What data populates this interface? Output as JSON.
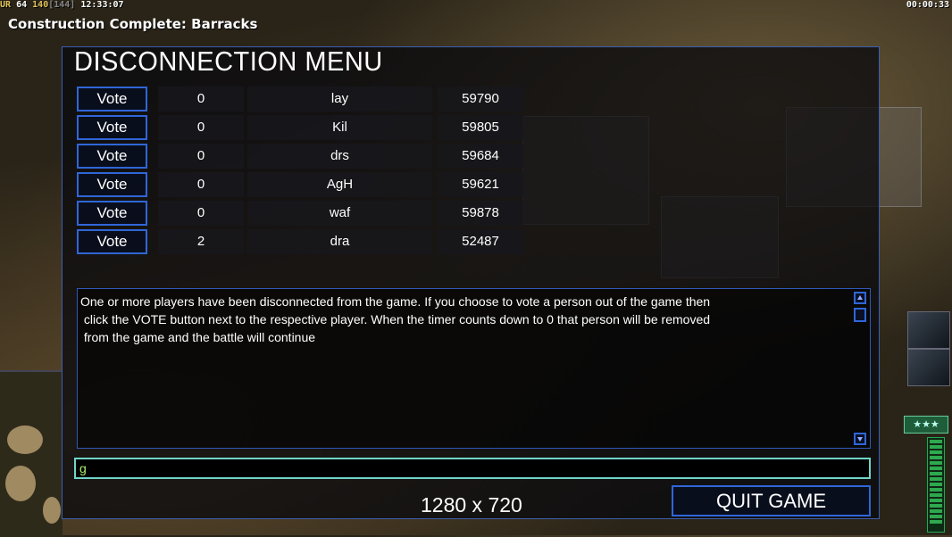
{
  "hud": {
    "ur_label": "UR",
    "stat_a": "64",
    "stat_b": "140",
    "stat_c": "[144]",
    "clock": "12:33:07",
    "game_timer": "00:00:33"
  },
  "notification": "Construction Complete: Barracks",
  "dialog": {
    "title": "DISCONNECTION MENU",
    "vote_label": "Vote",
    "players": [
      {
        "votes": "0",
        "name": "lay",
        "ping": "59790"
      },
      {
        "votes": "0",
        "name": "Kil",
        "ping": "59805"
      },
      {
        "votes": "0",
        "name": "drs",
        "ping": "59684"
      },
      {
        "votes": "0",
        "name": "AgH",
        "ping": "59621"
      },
      {
        "votes": "0",
        "name": "waf",
        "ping": "59878"
      },
      {
        "votes": "2",
        "name": "dra",
        "ping": "52487"
      }
    ],
    "message": "One or more players have been disconnected from the game. If you choose to vote a person out of the game then\n click the VOTE button next to the respective player. When the timer counts down to 0 that person will be removed\n from the game and the battle will continue",
    "chat_value": "g",
    "resolution": "1280 x 720",
    "quit_label": "QUIT GAME"
  },
  "sidebar": {
    "rank_stars": "★★★"
  },
  "colors": {
    "accent_blue": "#2f66d8",
    "chat_border": "#6fd6c8",
    "chat_text": "#aaf06a"
  }
}
